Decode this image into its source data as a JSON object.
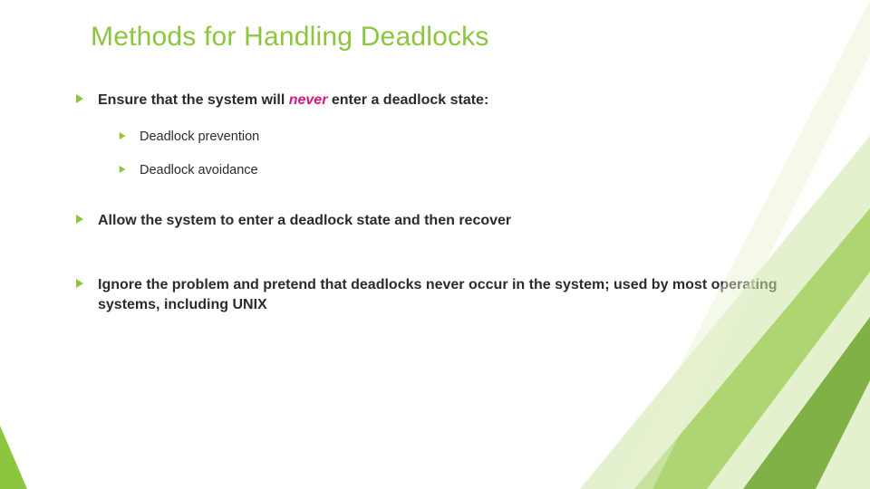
{
  "title": "Methods for Handling Deadlocks",
  "bullets": [
    {
      "level": 1,
      "prefix": "Ensure that the system will ",
      "emph": "never",
      "suffix": " enter a deadlock state:"
    },
    {
      "level": 2,
      "text": "Deadlock prevention"
    },
    {
      "level": 2,
      "text": "Deadlock avoidance"
    },
    {
      "level": 1,
      "text": "Allow the system to enter a deadlock state and then recover"
    },
    {
      "level": 1,
      "text": "Ignore the problem and pretend that deadlocks never occur in the system; used by most operating systems, including UNIX"
    }
  ],
  "colors": {
    "accent": "#8cc63f",
    "emphasis": "#d6187c",
    "deco_light": "#cde6a6",
    "deco_mid": "#9ecb54",
    "deco_dark": "#6fa62e"
  },
  "icons": {
    "bullet": "arrowhead-right"
  }
}
